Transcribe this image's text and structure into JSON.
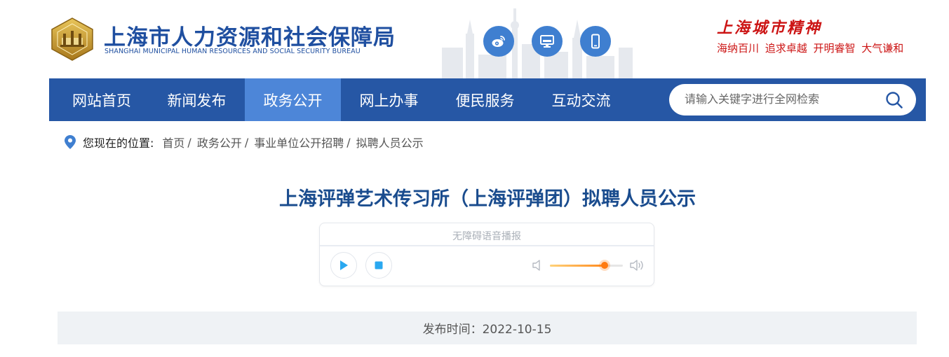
{
  "header": {
    "org_name_cn": "上海市人力资源和社会保障局",
    "org_name_en": "SHANGHAI MUNICIPAL HUMAN RESOURCES AND SOCIAL SECURITY BUREAU",
    "logo_icon": "bureau-emblem-icon",
    "social_icons": [
      "weibo-icon",
      "desktop-icon",
      "mobile-icon"
    ],
    "spirit_title": "上海城市精神",
    "spirit_motto": "海纳百川 追求卓越 开明睿智 大气谦和"
  },
  "nav": {
    "items": [
      {
        "label": "网站首页"
      },
      {
        "label": "新闻发布"
      },
      {
        "label": "政务公开"
      },
      {
        "label": "网上办事"
      },
      {
        "label": "便民服务"
      },
      {
        "label": "互动交流"
      }
    ],
    "active_index": 2,
    "search": {
      "placeholder": "请输入关键字进行全网检索",
      "value": ""
    }
  },
  "breadcrumb": {
    "lead": "您现在的位置:",
    "items": [
      {
        "label": "首页"
      },
      {
        "label": "政务公开"
      },
      {
        "label": "事业单位公开招聘"
      },
      {
        "label": "拟聘人员公示"
      }
    ]
  },
  "article": {
    "title": "上海评弹艺术传习所（上海评弹团）拟聘人员公示",
    "publish_time": "发布时间：2022-10-15"
  },
  "player": {
    "label": "无障碍语音播报",
    "progress_fraction": 0,
    "volume_fraction": 0.75
  },
  "colors": {
    "brand_blue": "#2657a5",
    "nav_active": "#4d86d8",
    "title_blue": "#1a4c8e",
    "spirit_red": "#cc1414",
    "volume_orange": "#ff7a10"
  }
}
